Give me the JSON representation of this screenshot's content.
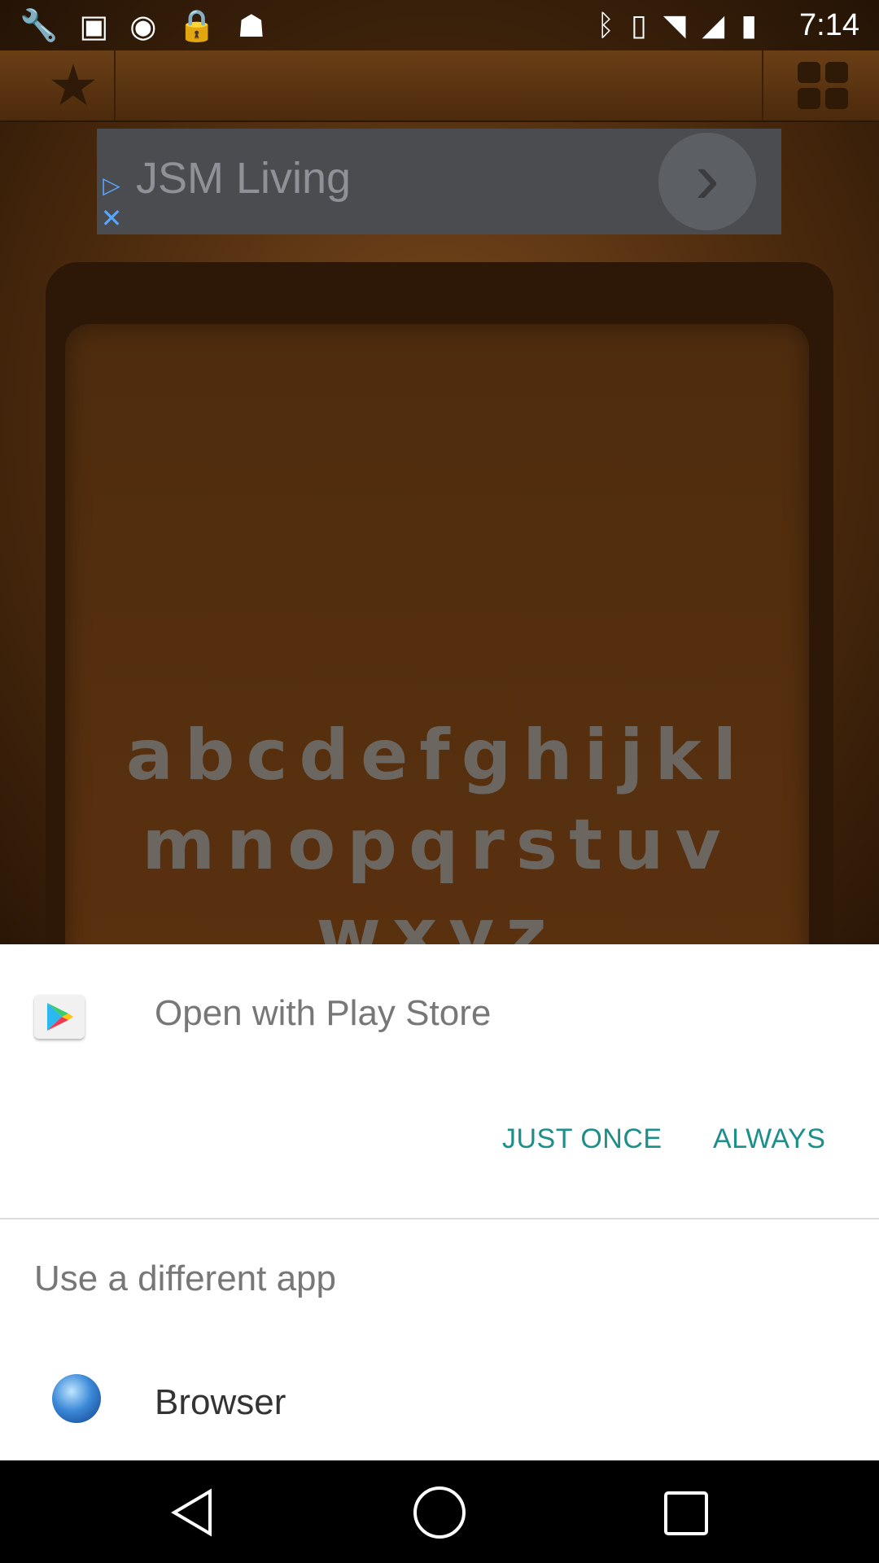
{
  "status_bar": {
    "time": "7:14",
    "left_icons": [
      "wrench-icon",
      "tab-icon",
      "timer-icon",
      "lock-icon",
      "android-icon"
    ],
    "right_icons": [
      "bluetooth-icon",
      "vibrate-icon",
      "wifi-icon",
      "signal-icon",
      "battery-icon"
    ]
  },
  "background_app": {
    "ad_text": "JSM Living",
    "alphabet_rows": [
      "abcdefghijkl",
      "mnopqrstuv",
      "wxyz"
    ]
  },
  "chooser": {
    "title": "Open with Play Store",
    "just_once_label": "JUST ONCE",
    "always_label": "ALWAYS",
    "different_app_label": "Use a different app",
    "apps": [
      {
        "label": "Browser",
        "icon": "globe-icon"
      }
    ]
  },
  "colors": {
    "accent": "#1d8f8a",
    "sheet_bg": "#ffffff",
    "muted_text": "#777777"
  }
}
